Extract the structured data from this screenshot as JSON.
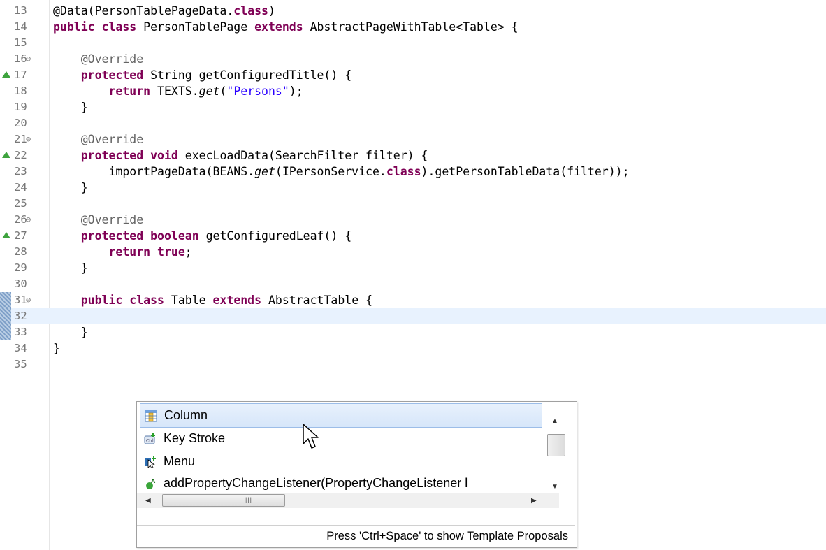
{
  "editor": {
    "lines": [
      {
        "n": "13",
        "parts": [
          {
            "t": "@Data(PersonTablePageData.",
            "c": ""
          },
          {
            "t": "class",
            "c": "kw"
          },
          {
            "t": ")",
            "c": ""
          }
        ]
      },
      {
        "n": "14",
        "parts": [
          {
            "t": "public",
            "c": "kw"
          },
          {
            "t": " ",
            "c": ""
          },
          {
            "t": "class",
            "c": "kw"
          },
          {
            "t": " PersonTablePage ",
            "c": ""
          },
          {
            "t": "extends",
            "c": "kw"
          },
          {
            "t": " AbstractPageWithTable<Table> {",
            "c": ""
          }
        ]
      },
      {
        "n": "15",
        "parts": []
      },
      {
        "n": "16",
        "fold": true,
        "parts": [
          {
            "t": "    @Override",
            "c": "ann"
          }
        ]
      },
      {
        "n": "17",
        "override": true,
        "parts": [
          {
            "t": "    ",
            "c": ""
          },
          {
            "t": "protected",
            "c": "kw"
          },
          {
            "t": " String getConfiguredTitle() {",
            "c": ""
          }
        ]
      },
      {
        "n": "18",
        "parts": [
          {
            "t": "        ",
            "c": ""
          },
          {
            "t": "return",
            "c": "kw"
          },
          {
            "t": " TEXTS.",
            "c": ""
          },
          {
            "t": "get",
            "c": "it"
          },
          {
            "t": "(",
            "c": ""
          },
          {
            "t": "\"Persons\"",
            "c": "str"
          },
          {
            "t": ");",
            "c": ""
          }
        ]
      },
      {
        "n": "19",
        "parts": [
          {
            "t": "    }",
            "c": ""
          }
        ]
      },
      {
        "n": "20",
        "parts": []
      },
      {
        "n": "21",
        "fold": true,
        "parts": [
          {
            "t": "    @Override",
            "c": "ann"
          }
        ]
      },
      {
        "n": "22",
        "override": true,
        "parts": [
          {
            "t": "    ",
            "c": ""
          },
          {
            "t": "protected",
            "c": "kw"
          },
          {
            "t": " ",
            "c": ""
          },
          {
            "t": "void",
            "c": "kw"
          },
          {
            "t": " execLoadData(SearchFilter filter) {",
            "c": ""
          }
        ]
      },
      {
        "n": "23",
        "parts": [
          {
            "t": "        importPageData(BEANS.",
            "c": ""
          },
          {
            "t": "get",
            "c": "it"
          },
          {
            "t": "(IPersonService.",
            "c": ""
          },
          {
            "t": "class",
            "c": "kw"
          },
          {
            "t": ").getPersonTableData(filter));",
            "c": ""
          }
        ]
      },
      {
        "n": "24",
        "parts": [
          {
            "t": "    }",
            "c": ""
          }
        ]
      },
      {
        "n": "25",
        "parts": []
      },
      {
        "n": "26",
        "fold": true,
        "parts": [
          {
            "t": "    @Override",
            "c": "ann"
          }
        ]
      },
      {
        "n": "27",
        "override": true,
        "parts": [
          {
            "t": "    ",
            "c": ""
          },
          {
            "t": "protected",
            "c": "kw"
          },
          {
            "t": " ",
            "c": ""
          },
          {
            "t": "boolean",
            "c": "kw"
          },
          {
            "t": " getConfiguredLeaf() {",
            "c": ""
          }
        ]
      },
      {
        "n": "28",
        "parts": [
          {
            "t": "        ",
            "c": ""
          },
          {
            "t": "return",
            "c": "kw"
          },
          {
            "t": " ",
            "c": ""
          },
          {
            "t": "true",
            "c": "kw"
          },
          {
            "t": ";",
            "c": ""
          }
        ]
      },
      {
        "n": "29",
        "parts": [
          {
            "t": "    }",
            "c": ""
          }
        ]
      },
      {
        "n": "30",
        "parts": []
      },
      {
        "n": "31",
        "fold": true,
        "changed": true,
        "parts": [
          {
            "t": "    ",
            "c": ""
          },
          {
            "t": "public",
            "c": "kw"
          },
          {
            "t": " ",
            "c": ""
          },
          {
            "t": "class",
            "c": "kw"
          },
          {
            "t": " Table ",
            "c": ""
          },
          {
            "t": "extends",
            "c": "kw"
          },
          {
            "t": " AbstractTable {",
            "c": ""
          }
        ]
      },
      {
        "n": "32",
        "changed": true,
        "current": true,
        "parts": []
      },
      {
        "n": "33",
        "changed": true,
        "parts": [
          {
            "t": "    }",
            "c": ""
          }
        ]
      },
      {
        "n": "34",
        "parts": [
          {
            "t": "}",
            "c": ""
          }
        ]
      },
      {
        "n": "35",
        "parts": []
      }
    ]
  },
  "proposals": {
    "items": [
      {
        "label": "Column",
        "icon": "column-icon",
        "selected": true
      },
      {
        "label": "Key Stroke",
        "icon": "keystroke-icon",
        "selected": false
      },
      {
        "label": "Menu",
        "icon": "menu-icon",
        "selected": false
      },
      {
        "label": "addPropertyChangeListener(PropertyChangeListener l",
        "icon": "method-icon",
        "selected": false
      }
    ],
    "status": "Press 'Ctrl+Space' to show Template Proposals"
  },
  "colors": {
    "keyword": "#7f0055",
    "annotation": "#646464",
    "string": "#2a00ff",
    "current_line": "#e8f2fe",
    "override_marker": "#3ea33e"
  }
}
